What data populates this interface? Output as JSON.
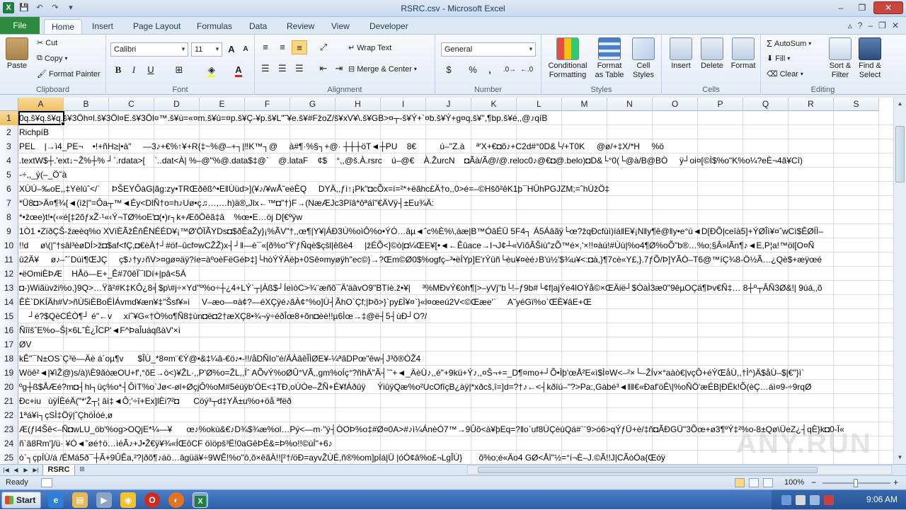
{
  "window": {
    "title": "RSRC.csv - Microsoft Excel",
    "minimize_label": "–",
    "restore_label": "❐",
    "close_label": "✕"
  },
  "qat": {
    "app_icon": "X",
    "save_icon": "💾",
    "undo_icon": "↶",
    "redo_icon": "↷",
    "customize_icon": "▾"
  },
  "tabs": {
    "file": "File",
    "items": [
      "Home",
      "Insert",
      "Page Layout",
      "Formulas",
      "Data",
      "Review",
      "View",
      "Developer"
    ],
    "active": "Home"
  },
  "ribbon": {
    "clipboard": {
      "label": "Clipboard",
      "paste": "Paste",
      "cut": "Cut",
      "copy": "Copy",
      "format_painter": "Format Painter"
    },
    "font": {
      "label": "Font",
      "family": "Calibri",
      "size": "11",
      "bold": "B",
      "italic": "I",
      "underline": "U",
      "grow": "A",
      "shrink": "A"
    },
    "alignment": {
      "label": "Alignment",
      "wrap_text": "Wrap Text",
      "merge_center": "Merge & Center"
    },
    "number": {
      "label": "Number",
      "format": "General",
      "currency": "$",
      "percent": "%",
      "comma": ","
    },
    "styles": {
      "label": "Styles",
      "conditional_formatting_line1": "Conditional",
      "conditional_formatting_line2": "Formatting",
      "format_as_table_line1": "Format",
      "format_as_table_line2": "as Table",
      "cell_styles_line1": "Cell",
      "cell_styles_line2": "Styles"
    },
    "cells": {
      "label": "Cells",
      "insert": "Insert",
      "delete": "Delete",
      "format": "Format"
    },
    "editing": {
      "label": "Editing",
      "autosum": "AutoSum",
      "fill": "Fill",
      "clear": "Clear",
      "sort_filter_line1": "Sort &",
      "sort_filter_line2": "Filter",
      "find_select_line1": "Find &",
      "find_select_line2": "Select"
    }
  },
  "grid": {
    "columns": [
      "A",
      "B",
      "C",
      "D",
      "E",
      "F",
      "G",
      "H",
      "I",
      "J",
      "K",
      "L",
      "M",
      "N",
      "O",
      "P",
      "Q",
      "R",
      "S"
    ],
    "selected_column": "A",
    "selected_row": "1",
    "rows": [
      {
        "num": "1",
        "a": "0q.š¥q.š¥q.š¥3Öh¤l.š¥3Öl¤E.š¥3Öl¤™.š¥ù=«¤m.š¥ù=¤p.š¥Ç-¥p.š¥L\"˜¥e.š¥#FžoZ/š¥xV¥\\.š¥GB>¤┬-š¥Ý+`¤b.š¥Ý+g¤q.š¥\",¶bp.š¥é,,@♪qíB"
      },
      {
        "num": "2",
        "a": "RichpíB"
      },
      {
        "num": "3",
        "a": "PEL    |→ì4_PE¬    •!+ñH≥|•à\"     —3♪+€%↑¥+R{‡~%@–+┐|‼K™┐@     à#¶·%§┐+@· ┼┼┼öT◄┼PU    8€          ú–\"Z.à     ª'X+€◘õ♪+C2d#°0D&└/+T0K     @ø/+‡X/*H     %ö"
      },
      {
        "num": "4",
        "a": ".textW$┼.'ext↓~Ž%┼% ┘`.rdata>[    `..dat<À| %–@\"%@.data$‡@`    @.lataF    ¢$    °,,@š.À.rsrc    ú–@€    À.ŽurcN    ◘Ãà/Ã@/@.reloc0♪@€◘@.belo)◘D&└°0(└@à/B@BÒ     ÿ┘oi¤[©Ì$%o\"K%o¼?eÈ¬4ã¥Cî)"
      },
      {
        "num": "5",
        "a": "-÷,,_ý(–_Ö˜à"
      },
      {
        "num": "6",
        "a": "XÙÚ–‰oE,,‡Yèlùˆ</`     ÞŠEYÔàG|ãg:zy•TRŒðêß^•E‖Ùüd>](¥♪/¥wÅ˜eèÈQ     DYÄ,,ƒì↑¡Pk\"◘cÕx=í=²*+ëãhc£Ä†o,,0>é=–©Hšõ²êK1þ¯HÜhPGJZM;=ˆhÚžÖ‡"
      },
      {
        "num": "7",
        "a": "*Ü8◘>Ä¤¶¾{◄(ìž|\"=Ôa┬™◄Éy<DlÑ†o=h♪Uø•ç♫…,…h)ä®„Jlx←™◘\"†)F→(NæÆJc3Pîâ*ôªáî\"€ÄVÿ┤±Eu¾Ä:"
      },
      {
        "num": "8",
        "a": "*•žœe)t!•(‹«é[‡2õƒxŽ·¹«‹Ý¬TØ%oE'◘(•)r┐k+ÆõÖêã‡â    %œ•E…öj D[€ºÿw"
      },
      {
        "num": "9",
        "a": "1Ò1 •ZïðÇŠ-žæèq%o XVíÈÃžÊñÊNÉÉD¥¡™Ø'ÖÏÃYDs◘$ðÊaŽy}¡%ÃV\"†,,œ¶|Y¥|ÁÐ3Ù%oìÔ%o•ÝÓ…âµ◄ˆc%È%\\,áæ|B™ÓâÉÜ 5F4┐ Á5Áâãÿ└œ?žqÐcfùì)íá‖E¥¡N‖y¶ê@‖y•e°ù◄D[ÐÕ|ceîà5]+ÝØÎì¥¤ˆwCì$ÊØÍÌ–"
      },
      {
        "num": "10",
        "a": "!!d     ø\\(|\"†sâl³èøDÍ>ž◘$af<fÇ,◘€èÀ†┘#öf–ûcf¤wCŽŽ)x┤┘‖—è¯«[ð%o\"Ÿ'ƒÑqè$çšl|êßè4     |žÉÕ<]©ò|◘¼ŒE¥[•◄←Êûace→I¬J¢┴«VìõÂŠiù\"zÕ™é×,'×!!¤àú!#Ùù|%o4¶Ø%oÕ\"b®…%o;§Â»lÃn¶♪◄E,P¦a!™öl[O¤Ñ"
      },
      {
        "num": "11",
        "a": "û2Ä¥     ø♪–ˆ´Dúì¶ŒJÇ     ç$♪†y♪ñV>¤gø¤äÿ?íe=àºoèFëGéÞ‡]└hòÝÝÄëþ+0Sê¤myøÿh\"ec©}→?Œm©Ø0$%ogfç–³•ëÍYp]E'rÝüñ└èu¥¤èé♪B'ú½'$¾u¥<:◘à,}¶7cè«Y£,}.7ƒÕ/Þ]YÃÒ–T6@™íÇ¾8-Ö½Ã…¿Qè$+æÿœé"
      },
      {
        "num": "12",
        "a": "•ëOmiÈÞÆ    HÅö—E+_Ê#70êÏ¯lDí+|pâ<5Á"
      },
      {
        "num": "13",
        "a": "◘-)Wiãüvži%o,}9Q>…Ÿã²#K‡KÔ¿8╡$p\\#j÷×Yd\"º%o÷┼¿4+LÝ`┬|Àß$┘ÍeìòC>¾¨æñõ¯Ä'äâvO9\"BTíè.ž•¥|     ³%MÐvÝ€òh¶|>–yVj\"b└!–ƒ9b#└¢f|ajÝe4lOÝå©×ŒÄië┘$ÒàÌ3æ0\"9êµOÇä¶Þv€Ñ‡… 8┼º┬ÂÑ3Ø&!| 9úá,,õ"
      },
      {
        "num": "14",
        "a": "ÊÈ`DKÍÄh#V>ñÙ5iÈBoÉÌÁvmd¥æn¥‡\"Šsf¥»ì     V–æo—¤à¢?—éXÇÿé♪ãÀ¢°%o]Ù┤ÃhO`Çf;|Þõ>}`py£Ì¥¤`}«l¤œeú2V<©Œæe'`     A˜yéGï%o`ŒÈ¥âE+Œ"
      },
      {
        "num": "15",
        "a": "    ┘é?$QèCÉÒ¶┘ é\"←v     xíˆ¥G«†Ò%o¶Ñ8‡ùn◘ë◘2†æXÇ8•¾¬ÿ÷éðÎœ8+õn◘èè!!µ6Ìœ→‡@ë┤5┤ùÐ┘O?/"
      },
      {
        "num": "16",
        "a": "ÑîîšˆE%o–Š|×6L˜È¿ÎCP'◄F^ÞaÎuáqßàV'×ì"
      },
      {
        "num": "17",
        "a": "ØV"
      },
      {
        "num": "18",
        "a": "kÊ\"¯N±OS`Ç³ë—Äè á´oµ¶v      $ÎÙ_*8¤m¨€Ý@•&‡¼â-€ö♪•-!!/åDÑIo\"é/ÄÀâêÎÌØE¥-¼ªâDPœ\"êw┤J³õ®ÒŽ4"
      },
      {
        "num": "19",
        "a": "Wöê²◄|¥ìŽ@)s/à)\\È9ãòæOU+f',°õE→ò<)¥ŽL·,,P'Ø%o=ŽL,,Íˆ AÕvÝ%oØÛ°VÃ,,gm%oÍç°?ñhÄ\"Ã┤`˜+◄_ÄèÙ♪,,é\"+9kü+Ý♪,,¤Š¬+=_D¶¤mo+┘Õ•Ìþ'œÅ²E«ì$Ì¤W<–²×└–ŽÍv×°aàò€|vçÔ+éÝŒåÙ,,†Ì^)Ä$åÙ–$|€\"}ì`"
      },
      {
        "num": "20",
        "a": "ºg┼ß$ÅÆé?m◘┤hl┐üç%o*┤ÔìT%o`Jø<-øl+ØçjÔ%oM#5éüÿb'ÓE<‡TÐ,oÙÒe–ŽÑ+É¥fÁðûÿ     ÝiûÿQæ%o²UcOfîçB¿àÿ|*xðcš,î=]d=?†♪←<┤kðîú–\"?>Pa:,Gàbé³◄‖‖€«Ðaf'öÊ\\|%oÑÖ'æÉB|ÐÉk!Õ(èÇ…áì¤9-÷9rqØ"
      },
      {
        "num": "21",
        "a": "Ðc+iu   ùÿÍÈéÄ(\"*'Ž┬¦ âì‡◄Ô;'÷î+Ex]lÈi?²◘      Cöý³┬d‡YÄ±u%o+öå ªfëð"
      },
      {
        "num": "22",
        "a": "1ªá¥ì┐çSÌ‡Öÿ|ˆÇhöÌóé,ø"
      },
      {
        "num": "23",
        "a": "Æ(ƒl4Šê<–Ñ◘wLU_öb'%og>OQjE*¼—¥      œ♪%okù&€♪D¾$¾æ%ol…Pý<—m·\"ý┤ÒOÞ%o‡#Ø¤0A>#♪ì¼ÁnèÓ7™→9Ûõ<à¥þEq=?‖o`uf8ÙÇèùQá#`¨9>ó6>qÝƒÜ+è/‡ñ◘ÃÐGÜ\"3Õœ+ø3¶ºÝ‡²%o-8±Qø\\ÜeZ¿┤qÈ}k◘0-Ï«"
      },
      {
        "num": "24",
        "a": "ñ`â8Rm']/ü· ¥Ó◄˜øé†ö…ìéÃ♪+J•Ž€ÿ¥¾«ÍŒôCF öìöpš³Ë!0aGêÞÉ&=Þ%o!!©ùÍ\"+6♪"
      },
      {
        "num": "25",
        "a": "ò`┐çpÍÙ/á /ÉMá5ð¯┼Ã+9ÛÊa,²?|ðõ¶♪áö…âgüä¥÷9WÊ!%o\"ô,õ×êãÀ!![²†/öÐ=ayvŽÙÉ,ñ®%om]pîá|Ü |óÓ¢â%o£¬LgÎÙ}       õ%o;é«Äo4 GØ<Åî\"½=°í¬È–J.©Ã!!J|CÃòÓa{Œóÿ"
      }
    ]
  },
  "sheets": {
    "active": "RSRC",
    "new_sheet_icon": "⊞"
  },
  "status": {
    "ready": "Ready",
    "zoom": "100%",
    "zoom_out": "−",
    "zoom_in": "+"
  },
  "taskbar": {
    "start": "Start",
    "clock": "9:06 AM"
  },
  "watermark": "ANY.RUN"
}
